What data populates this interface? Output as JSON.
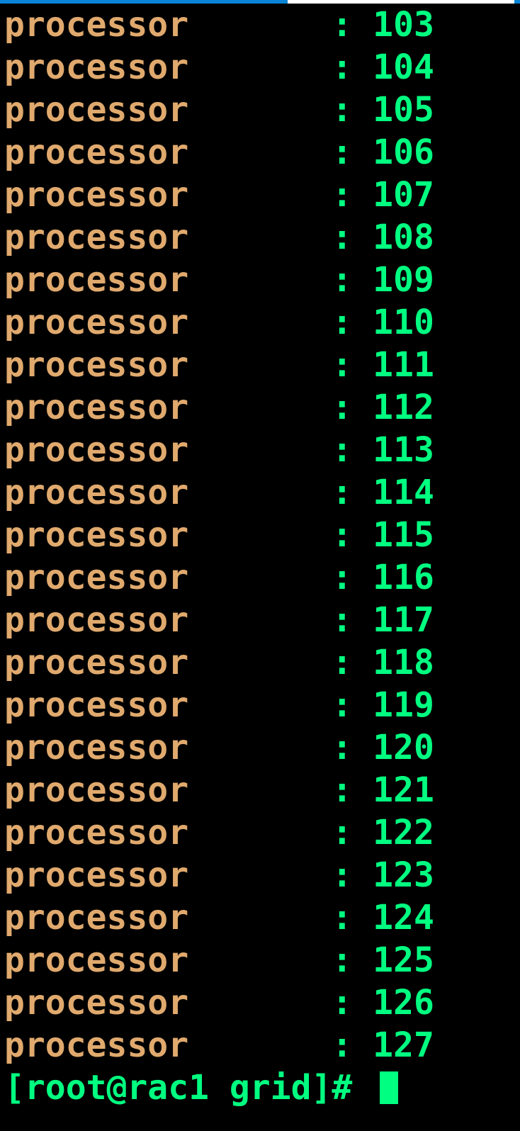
{
  "terminal": {
    "label": "processor",
    "rows": [
      {
        "value": "103"
      },
      {
        "value": "104"
      },
      {
        "value": "105"
      },
      {
        "value": "106"
      },
      {
        "value": "107"
      },
      {
        "value": "108"
      },
      {
        "value": "109"
      },
      {
        "value": "110"
      },
      {
        "value": "111"
      },
      {
        "value": "112"
      },
      {
        "value": "113"
      },
      {
        "value": "114"
      },
      {
        "value": "115"
      },
      {
        "value": "116"
      },
      {
        "value": "117"
      },
      {
        "value": "118"
      },
      {
        "value": "119"
      },
      {
        "value": "120"
      },
      {
        "value": "121"
      },
      {
        "value": "122"
      },
      {
        "value": "123"
      },
      {
        "value": "124"
      },
      {
        "value": "125"
      },
      {
        "value": "126"
      },
      {
        "value": "127"
      }
    ],
    "prompt": "[root@rac1 grid]# "
  }
}
